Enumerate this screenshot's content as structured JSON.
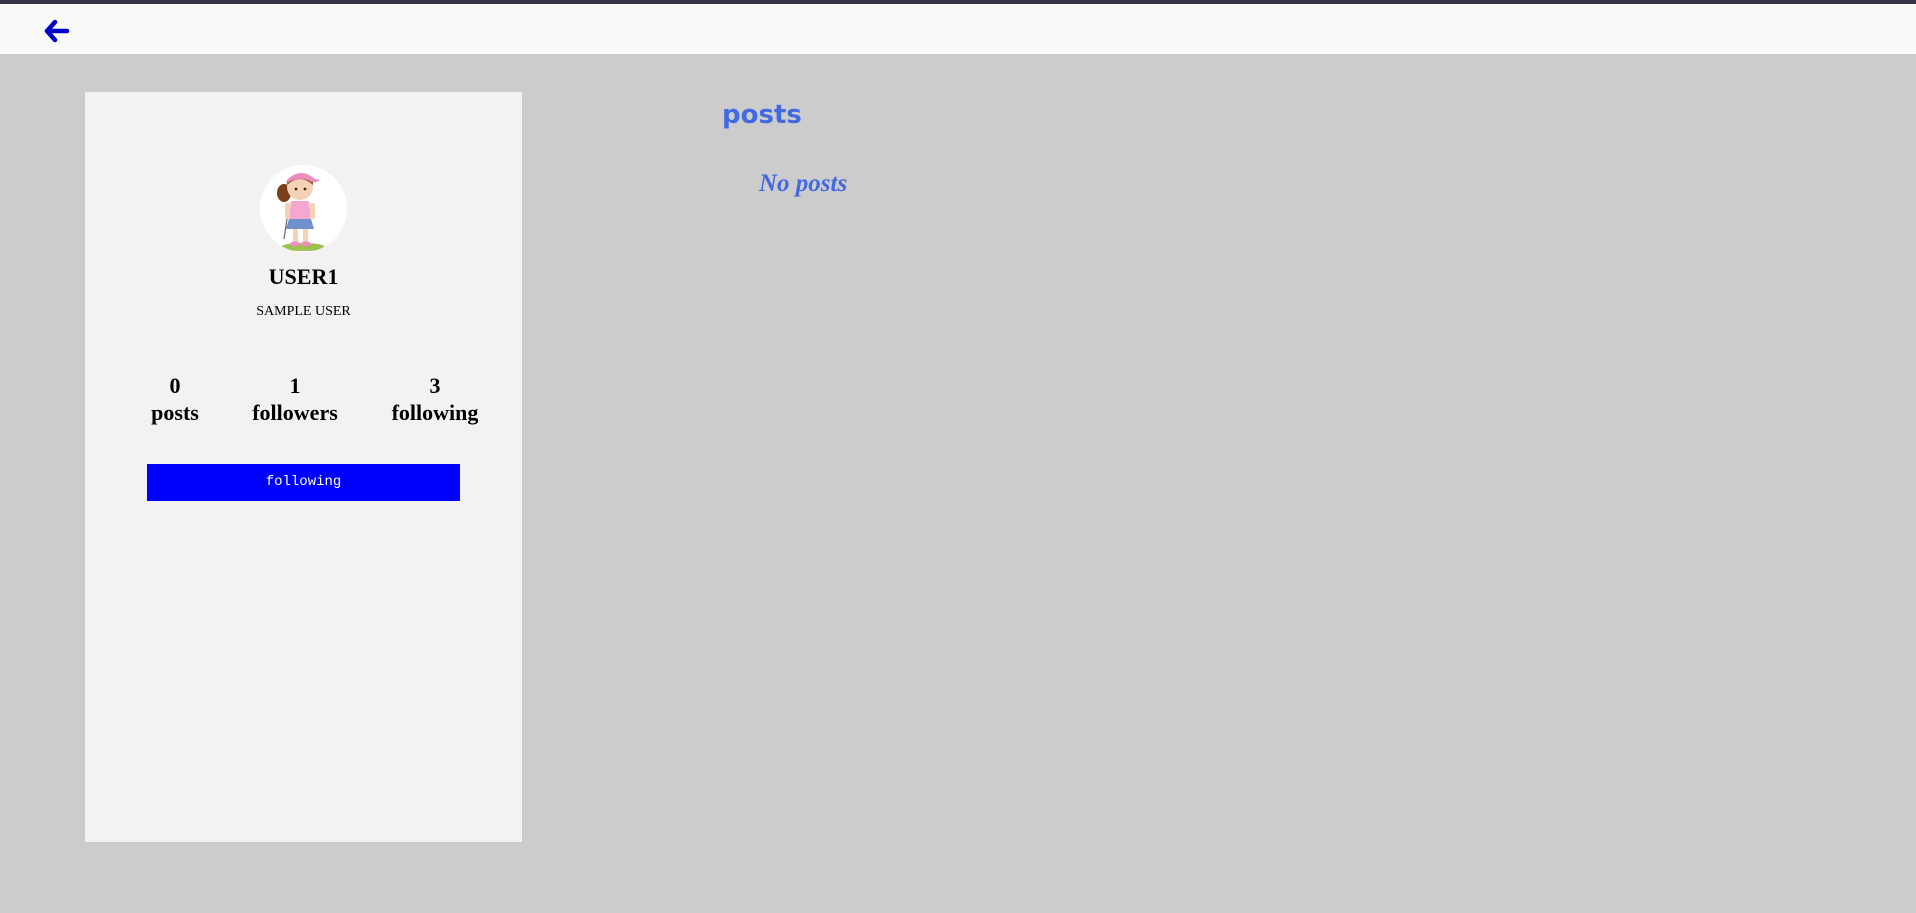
{
  "topbar": {
    "back_icon": "arrow-left-icon",
    "accent_color": "#0000cc"
  },
  "profile": {
    "avatar_icon": "avatar-image",
    "username": "USER1",
    "full_name": "SAMPLE USER",
    "stats": {
      "posts": {
        "count": "0",
        "label": "posts"
      },
      "followers": {
        "count": "1",
        "label": "followers"
      },
      "following": {
        "count": "3",
        "label": "following"
      }
    },
    "follow_button_label": "following",
    "follow_button_color": "#0000ff"
  },
  "feed": {
    "title": "posts",
    "empty_message": "No posts",
    "accent_color": "#4169e1"
  }
}
